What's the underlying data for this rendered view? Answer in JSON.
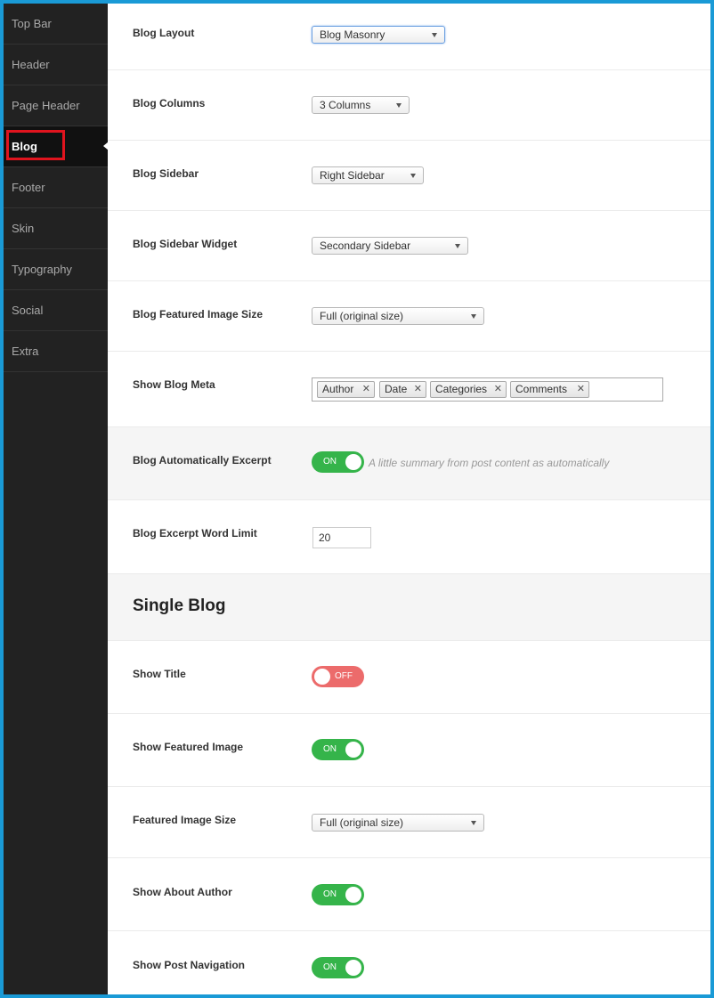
{
  "sidebar": {
    "items": [
      {
        "label": "Top Bar"
      },
      {
        "label": "Header"
      },
      {
        "label": "Page Header"
      },
      {
        "label": "Blog"
      },
      {
        "label": "Footer"
      },
      {
        "label": "Skin"
      },
      {
        "label": "Typography"
      },
      {
        "label": "Social"
      },
      {
        "label": "Extra"
      }
    ],
    "active": "Blog"
  },
  "blog": {
    "layout": {
      "label": "Blog Layout",
      "value": "Blog Masonry"
    },
    "columns": {
      "label": "Blog Columns",
      "value": "3 Columns"
    },
    "sidebar": {
      "label": "Blog Sidebar",
      "value": "Right Sidebar"
    },
    "sidebar_widget": {
      "label": "Blog Sidebar Widget",
      "value": "Secondary Sidebar"
    },
    "featured_image_size": {
      "label": "Blog Featured Image Size",
      "value": "Full (original size)"
    },
    "meta": {
      "label": "Show Blog Meta",
      "tags": [
        "Author",
        "Date",
        "Categories",
        "Comments"
      ],
      "remove_glyph": "✕"
    },
    "auto_excerpt": {
      "label": "Blog Automatically Excerpt",
      "state": "ON",
      "description": "A little summary from post content as automatically"
    },
    "excerpt_limit": {
      "label": "Blog Excerpt Word Limit",
      "value": "20"
    }
  },
  "single_blog": {
    "title": "Single Blog",
    "show_title": {
      "label": "Show Title",
      "state": "OFF"
    },
    "show_featured_image": {
      "label": "Show Featured Image",
      "state": "ON"
    },
    "featured_image_size": {
      "label": "Featured Image Size",
      "value": "Full (original size)"
    },
    "show_about_author": {
      "label": "Show About Author",
      "state": "ON"
    },
    "show_post_navigation": {
      "label": "Show Post Navigation",
      "state": "ON"
    }
  },
  "colors": {
    "frame_border": "#1a9ad6",
    "sidebar_bg": "#222222",
    "active_highlight": "#e0141e",
    "toggle_on": "#35b44a",
    "toggle_off": "#ec6b6b"
  }
}
